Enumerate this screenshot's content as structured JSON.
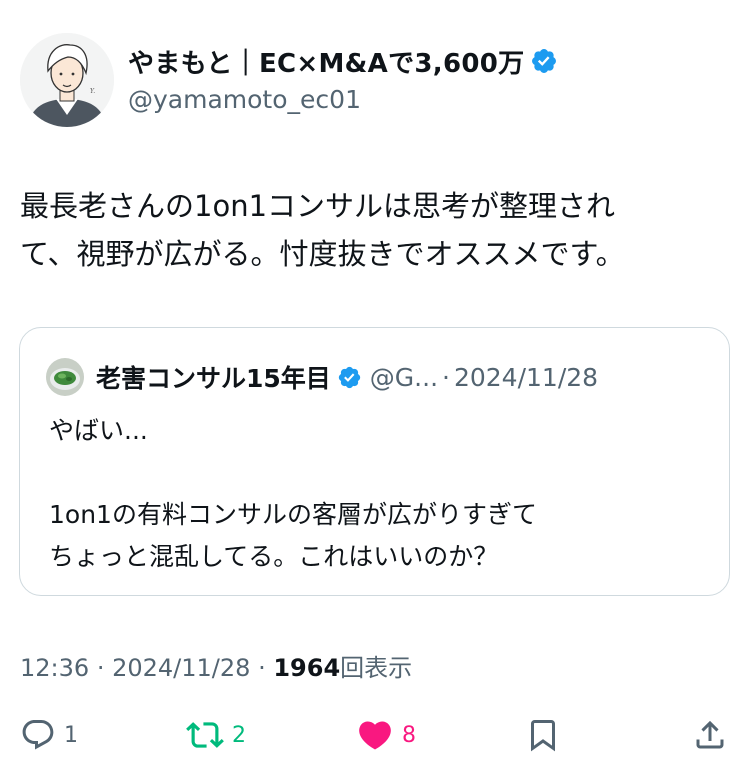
{
  "author": {
    "name": "やまもと｜EC×M&Aで3,600万",
    "handle": "@yamamoto_ec01",
    "verified": true,
    "avatar_icon": "illustrated-man-avatar"
  },
  "post": {
    "text": "最長老さんの1on1コンサルは思考が整理され\nて、視野が広がる。忖度抜きでオススメです。"
  },
  "quoted_post": {
    "author_name": "老害コンサル15年目",
    "handle": "@G...",
    "separator": "·",
    "date": "2024/11/28",
    "verified": true,
    "avatar_icon": "food-bowl-avatar",
    "text": "やばい...\n\n1on1の有料コンサルの客層が広がりすぎて\nちょっと混乱してる。これはいいのか？"
  },
  "meta": {
    "time": "12:36",
    "date": "2024/11/28",
    "separator": "·",
    "views_count": "1964",
    "views_label": "回表示"
  },
  "actions": {
    "reply_count": "1",
    "repost_count": "2",
    "like_count": "8"
  },
  "colors": {
    "verified": "#1d9bf0",
    "repost": "#00ba7c",
    "like": "#f91880",
    "secondary_text": "#536471"
  }
}
